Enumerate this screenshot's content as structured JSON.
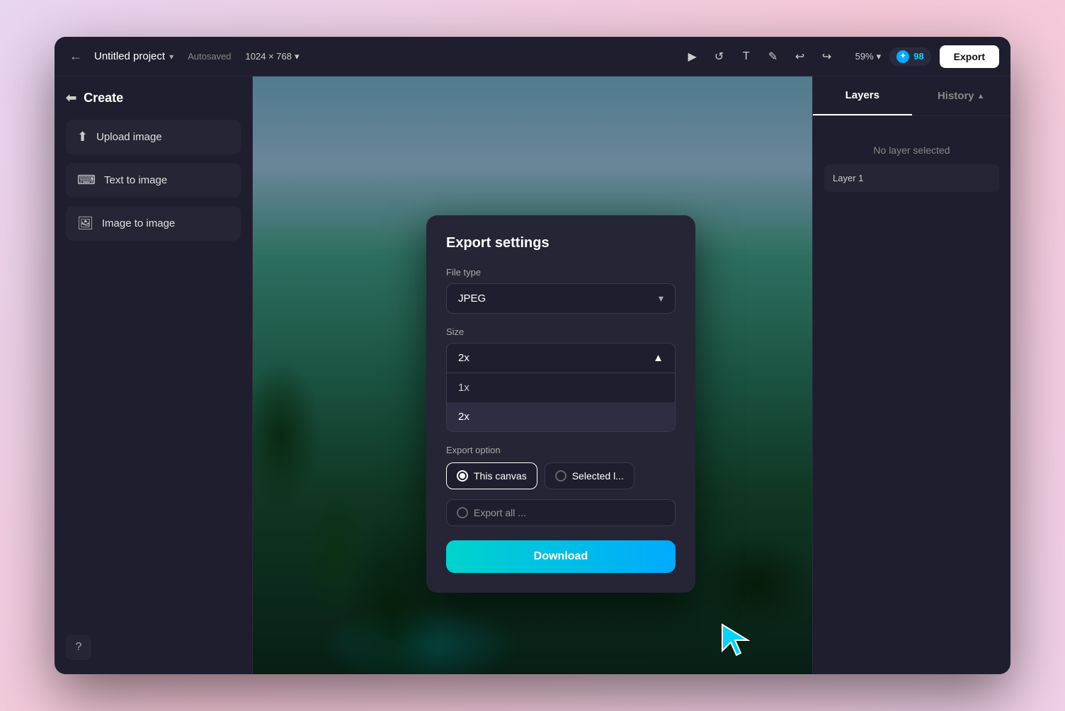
{
  "window": {
    "title": "Untitled project"
  },
  "topbar": {
    "back_label": "←",
    "project_title": "Untitled project",
    "project_chevron": "▾",
    "autosaved": "Autosaved",
    "dimensions": "1024 × 768",
    "dimensions_chevron": "▾",
    "tools": [
      "▶",
      "↺",
      "T",
      "✎",
      "↩",
      "↪"
    ],
    "zoom": "59%",
    "zoom_chevron": "▾",
    "credits": "98",
    "export_label": "Export"
  },
  "sidebar": {
    "create_label": "Create",
    "items": [
      {
        "id": "upload-image",
        "label": "Upload image",
        "icon": "⬆"
      },
      {
        "id": "text-to-image",
        "label": "Text to image",
        "icon": "⌨"
      },
      {
        "id": "image-to-image",
        "label": "Image to image",
        "icon": "🖼"
      }
    ],
    "help_icon": "?"
  },
  "right_panel": {
    "layers_tab": "Layers",
    "history_tab": "History",
    "history_chevron": "▲",
    "no_layer_text": "No layer selected",
    "layer_item": "Layer 1"
  },
  "export_modal": {
    "title": "Export settings",
    "file_type_label": "File type",
    "file_type_value": "JPEG",
    "file_type_chevron": "▾",
    "size_label": "Size",
    "size_selected": "2x",
    "size_chevron": "▲",
    "size_options": [
      "1x",
      "2x"
    ],
    "export_option_label": "Export option",
    "this_canvas_label": "This canvas",
    "selected_label": "Selected l...",
    "export_all_label": "Export all ...",
    "download_label": "Download"
  }
}
